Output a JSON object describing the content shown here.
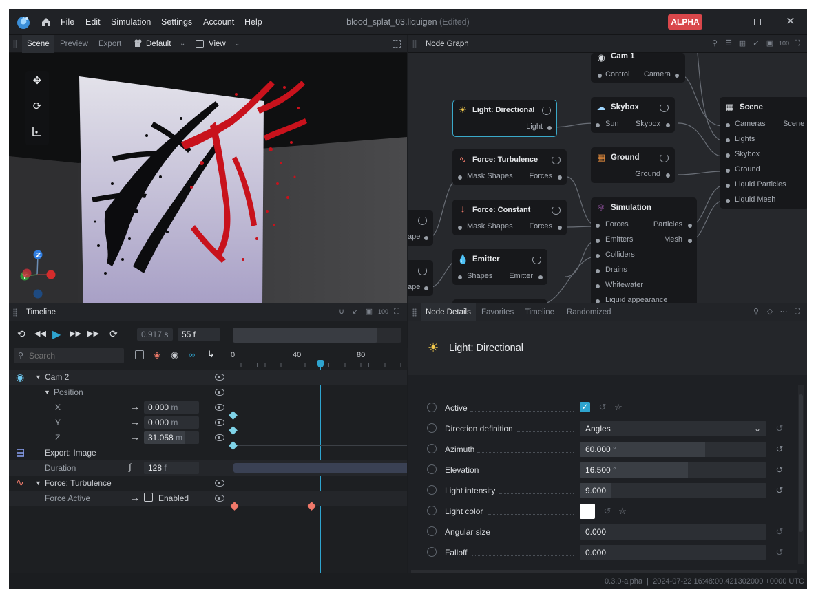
{
  "menu": [
    "File",
    "Edit",
    "Simulation",
    "Settings",
    "Account",
    "Help"
  ],
  "document": {
    "name": "blood_splat_03.liquigen",
    "status": "(Edited)"
  },
  "badge": "ALPHA",
  "viewport_panel": {
    "tabs": [
      "Scene",
      "Preview",
      "Export"
    ],
    "camera": "Default",
    "view": "View"
  },
  "node_graph": {
    "title": "Node Graph",
    "nodes": {
      "cam1": {
        "title": "Cam 1",
        "in": "Control",
        "out": "Camera"
      },
      "skybox": {
        "title": "Skybox",
        "in": "Sun",
        "out": "Skybox"
      },
      "scene": {
        "title": "Scene",
        "inputs": [
          "Cameras",
          "Lights",
          "Skybox",
          "Ground",
          "Liquid Particles",
          "Liquid Mesh"
        ],
        "out": "Scene"
      },
      "light": {
        "title": "Light: Directional",
        "out": "Light"
      },
      "turbulence": {
        "title": "Force: Turbulence",
        "in": "Mask Shapes",
        "out": "Forces"
      },
      "ground": {
        "title": "Ground",
        "out": "Ground"
      },
      "constant": {
        "title": "Force: Constant",
        "in": "Mask Shapes",
        "out": "Forces"
      },
      "simulation": {
        "title": "Simulation",
        "inputs": [
          "Forces",
          "Emitters",
          "Colliders",
          "Drains",
          "Whitewater",
          "Liquid appearance"
        ],
        "outputs": [
          "Particles",
          "Mesh"
        ]
      },
      "emitter": {
        "title": "Emitter",
        "in": "Shapes",
        "out": "Emitter"
      },
      "partial": {
        "out1": "ape",
        "out2": "ape"
      }
    }
  },
  "timeline": {
    "title": "Timeline",
    "time": "0.917",
    "time_unit": "s",
    "frame": "55 f",
    "search_placeholder": "Search",
    "ruler": [
      "0",
      "40",
      "80"
    ],
    "tracks": {
      "cam": "Cam 2",
      "position": "Position",
      "x": {
        "label": "X",
        "value": "0.000",
        "unit": "m"
      },
      "y": {
        "label": "Y",
        "value": "0.000",
        "unit": "m"
      },
      "z": {
        "label": "Z",
        "value": "31.058",
        "unit": "m"
      },
      "export": "Export: Image",
      "duration": {
        "label": "Duration",
        "value": "128",
        "unit": "f"
      },
      "force": "Force: Turbulence",
      "force_active": {
        "label": "Force Active",
        "value": "Enabled"
      }
    }
  },
  "details": {
    "tabs": [
      "Node Details",
      "Favorites",
      "Timeline",
      "Randomized"
    ],
    "heading": "Light: Directional",
    "rows": [
      {
        "label": "Active",
        "type": "checkbox",
        "checked": true
      },
      {
        "label": "Direction definition",
        "type": "select",
        "value": "Angles"
      },
      {
        "label": "Azimuth",
        "type": "slider",
        "value": "60.000",
        "unit": "°",
        "fraction": 0.67
      },
      {
        "label": "Elevation",
        "type": "slider",
        "value": "16.500",
        "unit": "°",
        "fraction": 0.58
      },
      {
        "label": "Light intensity",
        "type": "slider",
        "value": "9.000",
        "fraction": 0.17
      },
      {
        "label": "Light color",
        "type": "color",
        "value": "#ffffff"
      },
      {
        "label": "Angular size",
        "type": "slider",
        "value": "0.000",
        "fraction": 0
      },
      {
        "label": "Falloff",
        "type": "slider",
        "value": "0.000",
        "fraction": 0
      }
    ]
  },
  "status": {
    "version": "0.3.0-alpha",
    "timestamp": "2024-07-22 16:48:00.421302000 +0000 UTC",
    "separator": "|"
  },
  "colors": {
    "accent": "#2ea4cf",
    "alert": "#d9474b",
    "keyframe_blue": "#7fd3e8",
    "keyframe_red": "#f0786a"
  }
}
